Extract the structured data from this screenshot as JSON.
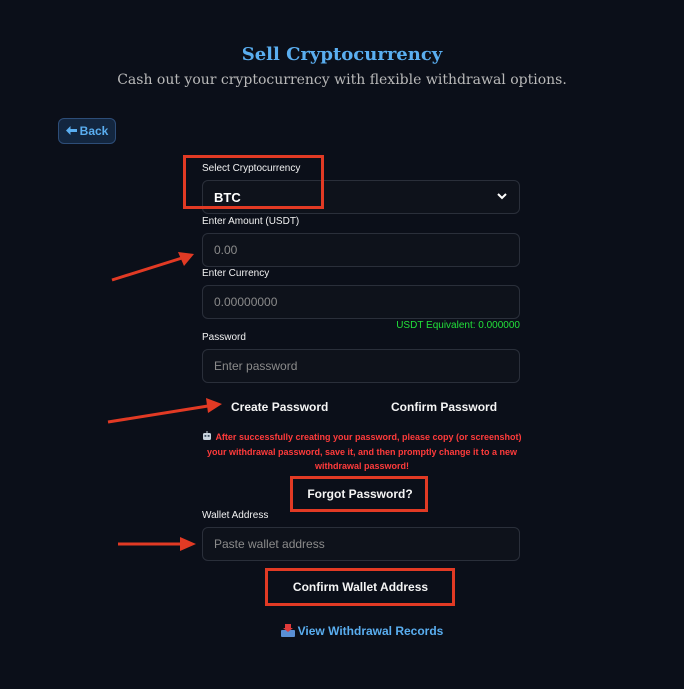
{
  "header": {
    "title": "Sell Cryptocurrency",
    "subtitle": "Cash out your cryptocurrency with flexible withdrawal options."
  },
  "back_button": {
    "label": "Back",
    "icon": "arrow-left-icon"
  },
  "form": {
    "crypto_label": "Select Cryptocurrency",
    "crypto_selected": "BTC",
    "amount_label": "Enter Amount (USDT)",
    "amount_placeholder": "0.00",
    "currency_label": "Enter Currency",
    "currency_placeholder": "0.00000000",
    "usdt_equivalent": "USDT Equivalent: 0.000000",
    "password_label": "Password",
    "password_placeholder": "Enter password",
    "create_password": "Create Password",
    "confirm_password": "Confirm Password",
    "warning": "After successfully creating your password, please copy (or screenshot) your withdrawal password, save it, and then promptly change it to a new withdrawal password!",
    "forgot_password": "Forgot Password?",
    "wallet_label": "Wallet Address",
    "wallet_placeholder": "Paste wallet address",
    "confirm_wallet": "Confirm Wallet Address"
  },
  "footer": {
    "records_link": "View Withdrawal Records",
    "records_icon": "inbox-tray-icon"
  },
  "colors": {
    "background": "#0b0f19",
    "accent": "#5aaef0",
    "annotation_red": "#e23a24",
    "success_green": "#22e03a",
    "warning_red": "#ff3b3b"
  }
}
